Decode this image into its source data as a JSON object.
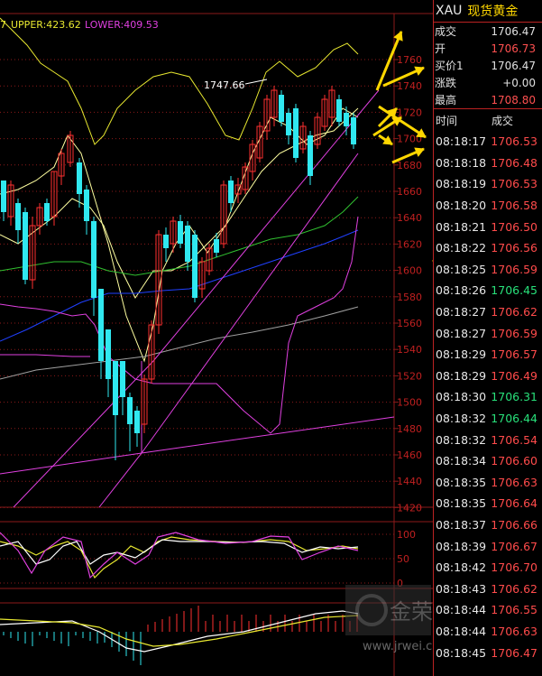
{
  "legend": {
    "prefix": "7",
    "upper": "UPPER:423.62",
    "lower": "LOWER:409.53"
  },
  "annotation": {
    "high_label": "1747.66"
  },
  "price_axis": [
    "1760",
    "1740",
    "1720",
    "1700",
    "1680",
    "1660",
    "1640",
    "1620",
    "1600",
    "1580",
    "1560",
    "1540",
    "1520",
    "1500",
    "1480",
    "1460",
    "1440",
    "1420"
  ],
  "osc_axis": [
    "100",
    "50",
    "0"
  ],
  "watermark": {
    "text": "金荣圈",
    "url": "www.jrwei.com"
  },
  "panel": {
    "symbol": "XAU",
    "name": "现货黄金",
    "quotes": [
      {
        "label": "成交",
        "value": "1706.47",
        "color": "white"
      },
      {
        "label": "开",
        "value": "1706.73",
        "color": "red"
      },
      {
        "label": "买价1",
        "value": "1706.47",
        "color": "white"
      },
      {
        "label": "涨跌",
        "value": "+0.00",
        "color": "white"
      },
      {
        "label": "最高",
        "value": "1708.80",
        "color": "red"
      }
    ],
    "ticks_header": {
      "time": "时间",
      "price": "成交"
    },
    "ticks": [
      {
        "time": "08:18:17",
        "price": "1706.53",
        "color": "red"
      },
      {
        "time": "08:18:18",
        "price": "1706.48",
        "color": "red"
      },
      {
        "time": "08:18:19",
        "price": "1706.53",
        "color": "red"
      },
      {
        "time": "08:18:20",
        "price": "1706.58",
        "color": "red"
      },
      {
        "time": "08:18:21",
        "price": "1706.50",
        "color": "red"
      },
      {
        "time": "08:18:22",
        "price": "1706.56",
        "color": "red"
      },
      {
        "time": "08:18:25",
        "price": "1706.59",
        "color": "red"
      },
      {
        "time": "08:18:26",
        "price": "1706.45",
        "color": "green"
      },
      {
        "time": "08:18:27",
        "price": "1706.62",
        "color": "red"
      },
      {
        "time": "08:18:27",
        "price": "1706.59",
        "color": "red"
      },
      {
        "time": "08:18:29",
        "price": "1706.57",
        "color": "red"
      },
      {
        "time": "08:18:29",
        "price": "1706.49",
        "color": "red"
      },
      {
        "time": "08:18:30",
        "price": "1706.31",
        "color": "green"
      },
      {
        "time": "08:18:32",
        "price": "1706.44",
        "color": "green"
      },
      {
        "time": "08:18:32",
        "price": "1706.54",
        "color": "red"
      },
      {
        "time": "08:18:34",
        "price": "1706.60",
        "color": "red"
      },
      {
        "time": "08:18:35",
        "price": "1706.63",
        "color": "red"
      },
      {
        "time": "08:18:35",
        "price": "1706.64",
        "color": "red"
      },
      {
        "time": "08:18:37",
        "price": "1706.66",
        "color": "red"
      },
      {
        "time": "08:18:39",
        "price": "1706.67",
        "color": "red"
      },
      {
        "time": "08:18:42",
        "price": "1706.70",
        "color": "red"
      },
      {
        "time": "08:18:43",
        "price": "1706.62",
        "color": "red"
      },
      {
        "time": "08:18:44",
        "price": "1706.55",
        "color": "red"
      },
      {
        "time": "08:18:44",
        "price": "1706.63",
        "color": "red"
      },
      {
        "time": "08:18:45",
        "price": "1706.47",
        "color": "red"
      }
    ]
  },
  "colors": {
    "bull": "#ff3030",
    "bear": "#30e8f0",
    "grid": "#8b1a1a",
    "ma_yellow": "#e8e830",
    "ma_green": "#30c030",
    "ma_blue": "#2040ff",
    "ma_gray": "#a0a0a0",
    "boll": "#e040e0",
    "arrow": "#ffd700"
  }
}
